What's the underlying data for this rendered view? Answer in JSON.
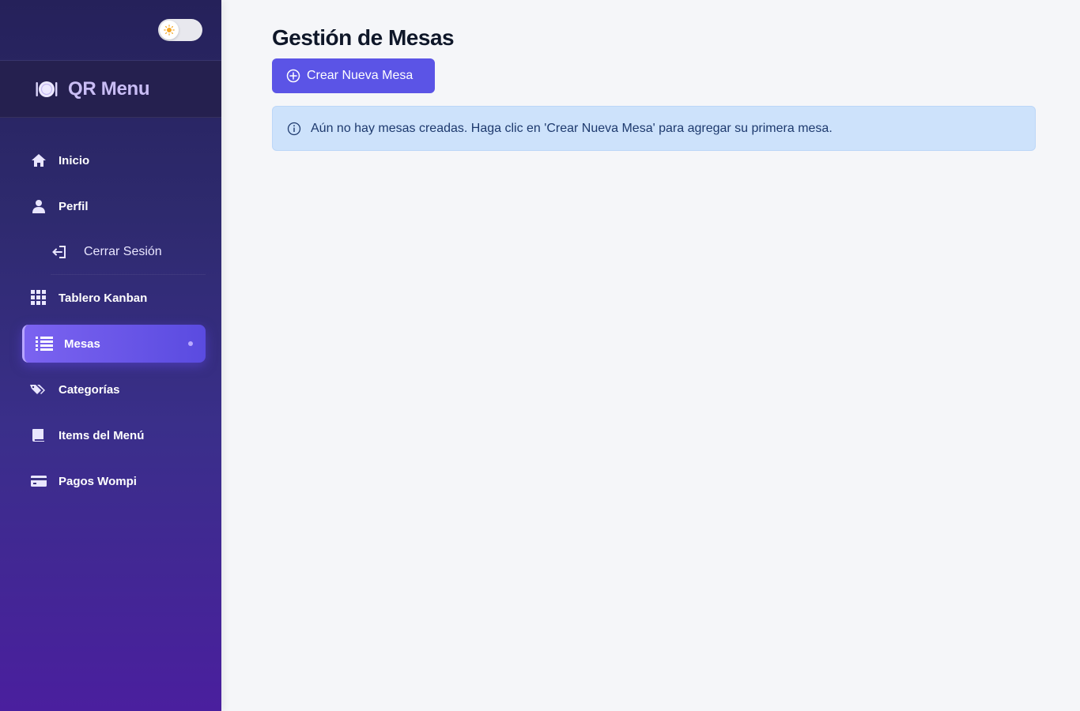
{
  "sidebar": {
    "brand_title": "QR Menu",
    "items": [
      {
        "label": "Inicio",
        "icon": "home-icon"
      },
      {
        "label": "Perfil",
        "icon": "user-icon"
      },
      {
        "label": "Cerrar Sesión",
        "icon": "logout-icon"
      },
      {
        "label": "Tablero Kanban",
        "icon": "grid-icon"
      },
      {
        "label": "Mesas",
        "icon": "list-icon",
        "active": true
      },
      {
        "label": "Categorías",
        "icon": "tags-icon"
      },
      {
        "label": "Items del Menú",
        "icon": "book-icon"
      },
      {
        "label": "Pagos Wompi",
        "icon": "credit-card-icon"
      }
    ]
  },
  "theme_toggle": {
    "icon": "sun-icon",
    "state": "light"
  },
  "main": {
    "title": "Gestión de Mesas",
    "create_button_label": "Crear Nueva Mesa",
    "alert_text": "Aún no hay mesas creadas. Haga clic en 'Crear Nueva Mesa' para agregar su primera mesa."
  },
  "colors": {
    "accent": "#5b54e6",
    "alert_bg": "#cde2fb",
    "sidebar_top": "#25215a",
    "sidebar_bottom": "#4a1f9e"
  }
}
